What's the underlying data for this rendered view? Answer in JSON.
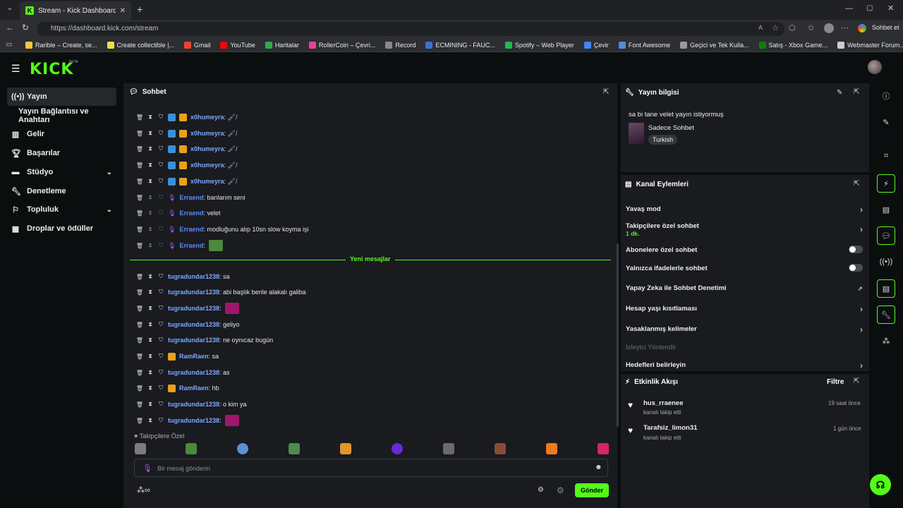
{
  "browser": {
    "tab_title": "Stream - Kick Dashboard",
    "url": "https://dashboard.kick.com/stream",
    "profile_button": "Sohbet et",
    "bookmarks": [
      {
        "label": "Rarible – Create, se...",
        "color": "#f5c542"
      },
      {
        "label": "Create collectible |...",
        "color": "#e8e04a"
      },
      {
        "label": "Gmail",
        "color": "#ea4335"
      },
      {
        "label": "YouTube",
        "color": "#ff0000"
      },
      {
        "label": "Haritalar",
        "color": "#34a853"
      },
      {
        "label": "RollerCoin – Çevri...",
        "color": "#e84393"
      },
      {
        "label": "Record",
        "color": "#888888"
      },
      {
        "label": "ECMINING - FAUC...",
        "color": "#3a6fd8"
      },
      {
        "label": "Spotify – Web Player",
        "color": "#1db954"
      },
      {
        "label": "Çevir",
        "color": "#4285f4"
      },
      {
        "label": "Font Awesome",
        "color": "#528dd7"
      },
      {
        "label": "Geçici ve Tek Kulla...",
        "color": "#999999"
      },
      {
        "label": "Satış - Xbox Game...",
        "color": "#107c10"
      },
      {
        "label": "Webmaster Forum...",
        "color": "#cccccc"
      }
    ]
  },
  "brand": {
    "logo": "KICK",
    "beta": "BETA"
  },
  "sidebar": {
    "items": [
      {
        "label": "Yayın",
        "icon": "broadcast-icon"
      },
      {
        "label": "Yayın Bağlantısı ve Anahtarı",
        "icon": ""
      },
      {
        "label": "Gelir",
        "icon": "chart-icon"
      },
      {
        "label": "Başarılar",
        "icon": "trophy-icon"
      },
      {
        "label": "Stüdyo",
        "icon": "studio-icon"
      },
      {
        "label": "Denetleme",
        "icon": "wrench-icon"
      },
      {
        "label": "Topluluk",
        "icon": "community-icon"
      },
      {
        "label": "Droplar ve ödüller",
        "icon": "gift-icon"
      }
    ]
  },
  "chat": {
    "title": "Sohbet",
    "messages": [
      {
        "user": "x0humeyra",
        "text": "🖌/",
        "color": "#7aa8ff"
      },
      {
        "user": "x0humeyra",
        "text": "🖌/",
        "color": "#7aa8ff"
      },
      {
        "user": "x0humeyra",
        "text": "🖌/",
        "color": "#7aa8ff"
      },
      {
        "user": "x0humeyra",
        "text": "🖌/",
        "color": "#7aa8ff"
      },
      {
        "user": "x0humeyra",
        "text": "🖌/",
        "color": "#7aa8ff"
      },
      {
        "user": "Erraend",
        "text": "banlarım seni",
        "color": "#5b8cff"
      },
      {
        "user": "Erraend",
        "text": "velet",
        "color": "#5b8cff"
      },
      {
        "user": "Erraend",
        "text": "modluğunu alıp 10sn slow koyma işi",
        "color": "#5b8cff"
      },
      {
        "user": "Erraend",
        "text": "",
        "color": "#5b8cff"
      },
      {
        "user": "tugradundar1238",
        "text": "sa",
        "color": "#7aa8ff"
      },
      {
        "user": "tugradundar1238",
        "text": "abi başlık benle alakalı galiba",
        "color": "#7aa8ff"
      },
      {
        "user": "tugradundar1238",
        "text": "",
        "color": "#7aa8ff"
      },
      {
        "user": "tugradundar1238",
        "text": "geliyo",
        "color": "#7aa8ff"
      },
      {
        "user": "tugradundar1238",
        "text": "ne oynıcaz bugün",
        "color": "#7aa8ff"
      },
      {
        "user": "RamRaen",
        "text": "sa",
        "color": "#7aa8ff"
      },
      {
        "user": "tugradundar1238",
        "text": "as",
        "color": "#7aa8ff"
      },
      {
        "user": "RamRaen",
        "text": "hb",
        "color": "#7aa8ff"
      },
      {
        "user": "tugradundar1238",
        "text": "o kim ya",
        "color": "#7aa8ff"
      },
      {
        "user": "tugradundar1238",
        "text": "",
        "color": "#7aa8ff"
      }
    ],
    "new_messages_label": "Yeni mesajlar",
    "emote_section_label": "♥ Takipçilere Özel",
    "input_placeholder": "Bir mesaj gönderin",
    "send_label": "Gönder"
  },
  "stream_info": {
    "title": "Yayın bilgisi",
    "stream_title": "sa bi tane velet yayın istiyormuş",
    "category": "Sadece Sohbet",
    "language_tag": "Turkish"
  },
  "channel_actions": {
    "title": "Kanal Eylemleri",
    "items": [
      {
        "label": "Yavaş mod",
        "control": "arrow"
      },
      {
        "label": "Takipçilere özel sohbet",
        "sub": "1 dk.",
        "control": "arrow"
      },
      {
        "label": "Abonelere özel sohbet",
        "control": "toggle"
      },
      {
        "label": "Yalnızca ifadelerle sohbet",
        "control": "toggle"
      },
      {
        "label": "Yapay Zeka ile Sohbet Denetimi",
        "control": "external"
      },
      {
        "label": "Hesap yaşı kısıtlaması",
        "control": "arrow"
      },
      {
        "label": "Yasaklanmış kelimeler",
        "control": "arrow"
      },
      {
        "label": "İzleyici Yönlendir",
        "control": "none"
      },
      {
        "label": "Hedefleri belirleyin",
        "control": "arrow"
      }
    ]
  },
  "activity": {
    "title": "Etkinlik Akışı",
    "filter_label": "Filtre",
    "events": [
      {
        "user": "hus_rraenee",
        "action": "kanalı takip etti",
        "time": "19 saat önce"
      },
      {
        "user": "Tarafsiz_limon31",
        "action": "kanalı takip etti",
        "time": "1 gün önce"
      }
    ]
  },
  "colors": {
    "accent": "#53fc18",
    "panel": "#191b1f",
    "bg": "#0b0e0f"
  }
}
